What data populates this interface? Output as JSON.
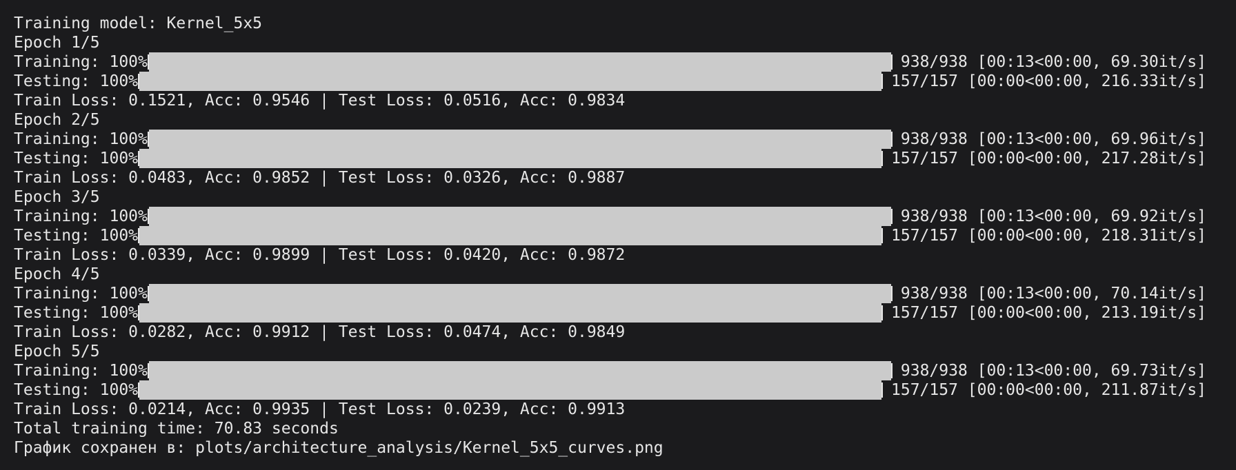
{
  "header": "Training model: Kernel_5x5",
  "epochs": [
    {
      "label": "Epoch 1/5",
      "training": {
        "prefix": "Training: 100%",
        "progress_percent": 100,
        "stats": "938/938 [00:13<00:00, 69.30it/s]"
      },
      "testing": {
        "prefix": "Testing: 100%",
        "progress_percent": 100,
        "stats": "157/157 [00:00<00:00, 216.33it/s]"
      },
      "summary": "Train Loss: 0.1521, Acc: 0.9546 | Test Loss: 0.0516, Acc: 0.9834"
    },
    {
      "label": "Epoch 2/5",
      "training": {
        "prefix": "Training: 100%",
        "progress_percent": 100,
        "stats": "938/938 [00:13<00:00, 69.96it/s]"
      },
      "testing": {
        "prefix": "Testing: 100%",
        "progress_percent": 100,
        "stats": "157/157 [00:00<00:00, 217.28it/s]"
      },
      "summary": "Train Loss: 0.0483, Acc: 0.9852 | Test Loss: 0.0326, Acc: 0.9887"
    },
    {
      "label": "Epoch 3/5",
      "training": {
        "prefix": "Training: 100%",
        "progress_percent": 100,
        "stats": "938/938 [00:13<00:00, 69.92it/s]"
      },
      "testing": {
        "prefix": "Testing: 100%",
        "progress_percent": 100,
        "stats": "157/157 [00:00<00:00, 218.31it/s]"
      },
      "summary": "Train Loss: 0.0339, Acc: 0.9899 | Test Loss: 0.0420, Acc: 0.9872"
    },
    {
      "label": "Epoch 4/5",
      "training": {
        "prefix": "Training: 100%",
        "progress_percent": 100,
        "stats": "938/938 [00:13<00:00, 70.14it/s]"
      },
      "testing": {
        "prefix": "Testing: 100%",
        "progress_percent": 100,
        "stats": "157/157 [00:00<00:00, 213.19it/s]"
      },
      "summary": "Train Loss: 0.0282, Acc: 0.9912 | Test Loss: 0.0474, Acc: 0.9849"
    },
    {
      "label": "Epoch 5/5",
      "training": {
        "prefix": "Training: 100%",
        "progress_percent": 100,
        "stats": "938/938 [00:13<00:00, 69.73it/s]"
      },
      "testing": {
        "prefix": "Testing: 100%",
        "progress_percent": 100,
        "stats": "157/157 [00:00<00:00, 211.87it/s]"
      },
      "summary": "Train Loss: 0.0214, Acc: 0.9935 | Test Loss: 0.0239, Acc: 0.9913"
    }
  ],
  "total_time": "Total training time: 70.83 seconds",
  "saved": "График сохранен в: plots/architecture_analysis/Kernel_5x5_curves.png",
  "colors": {
    "background": "#1b1b1d",
    "text": "#e6e6e6",
    "bar": "#cbcbcb"
  }
}
